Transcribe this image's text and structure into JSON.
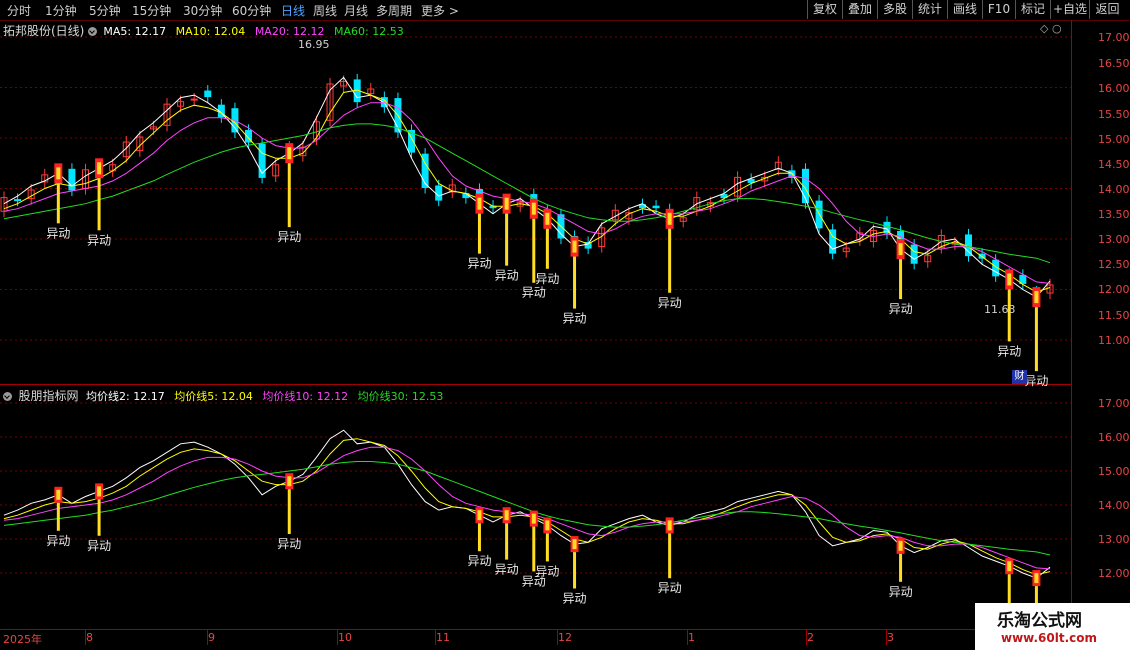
{
  "toolbar": {
    "periods": [
      "分时",
      "1分钟",
      "5分钟",
      "15分钟",
      "30分钟",
      "60分钟",
      "日线",
      "周线",
      "月线",
      "多周期",
      "更多 >"
    ],
    "active_period": "日线",
    "buttons": [
      "复权",
      "叠加",
      "多股",
      "统计",
      "画线",
      "F10",
      "标记",
      "+自选",
      "返回"
    ]
  },
  "main_panel": {
    "title": "拓邦股份(日线)",
    "ma_labels": [
      {
        "text": "MA5: 12.17",
        "color": "#ffffff"
      },
      {
        "text": "MA10: 12.04",
        "color": "#ffff00"
      },
      {
        "text": "MA20: 12.12",
        "color": "#ff44ff"
      },
      {
        "text": "MA60: 12.53",
        "color": "#22dd22"
      }
    ],
    "high_label": "16.95",
    "low_label": "11.63",
    "y_ticks": [
      "17.00",
      "16.50",
      "16.00",
      "15.50",
      "15.00",
      "14.50",
      "14.00",
      "13.50",
      "13.00",
      "12.50",
      "12.00",
      "11.50",
      "11.00"
    ],
    "cai_badge": "财"
  },
  "sub_panel": {
    "title": "股朋指标网",
    "labels": [
      {
        "text": "均价线2: 12.17",
        "color": "#ffffff"
      },
      {
        "text": "均价线5: 12.04",
        "color": "#ffff00"
      },
      {
        "text": "均价线10: 12.12",
        "color": "#ff44ff"
      },
      {
        "text": "均价线30: 12.53",
        "color": "#22dd22"
      }
    ],
    "y_ticks": [
      "17.00",
      "16.00",
      "15.00",
      "14.00",
      "13.00",
      "12.00"
    ]
  },
  "x_axis": [
    "2025年",
    "8",
    "9",
    "10",
    "11",
    "12",
    "1",
    "2",
    "3"
  ],
  "signal_label": "异动",
  "watermark": {
    "line1": "乐淘公式网",
    "line2": "www.60lt.com"
  },
  "colors": {
    "up": "#ff3b3b",
    "down": "#00e5ff",
    "ma5": "#ffffff",
    "ma10": "#ffff00",
    "ma20": "#ff44ff",
    "ma60": "#22dd22",
    "signal": "#ffdd22",
    "grid": "#7a0000"
  },
  "chart_data": {
    "type": "line",
    "title": "拓邦股份(日线)",
    "ylim": [
      10.7,
      17.3
    ],
    "x_ticks": [
      "2025年",
      "8",
      "9",
      "10",
      "11",
      "12",
      "1",
      "2",
      "3"
    ],
    "series": [
      {
        "name": "MA5",
        "values": [
          13.7,
          13.85,
          14.05,
          14.15,
          14.3,
          14.05,
          14.25,
          14.4,
          14.55,
          14.8,
          15.1,
          15.3,
          15.55,
          15.8,
          15.85,
          15.7,
          15.5,
          15.2,
          14.8,
          14.3,
          14.55,
          14.7,
          14.9,
          15.4,
          15.95,
          16.2,
          15.8,
          15.85,
          15.7,
          15.2,
          14.6,
          14.1,
          13.85,
          13.95,
          13.9,
          13.7,
          13.5,
          13.7,
          13.8,
          13.6,
          13.4,
          13.1,
          12.85,
          12.9,
          13.3,
          13.45,
          13.6,
          13.7,
          13.5,
          13.4,
          13.5,
          13.7,
          13.8,
          13.9,
          14.1,
          14.2,
          14.3,
          14.4,
          14.3,
          13.8,
          13.1,
          12.8,
          12.9,
          13.0,
          13.25,
          13.2,
          12.8,
          12.6,
          12.75,
          12.95,
          13.0,
          12.75,
          12.5,
          12.35,
          12.2,
          12.0,
          11.85,
          12.17
        ]
      },
      {
        "name": "MA10",
        "values": [
          13.6,
          13.7,
          13.85,
          14.0,
          14.1,
          14.05,
          14.1,
          14.2,
          14.35,
          14.55,
          14.85,
          15.1,
          15.35,
          15.55,
          15.65,
          15.6,
          15.5,
          15.3,
          15.0,
          14.7,
          14.6,
          14.6,
          14.7,
          15.0,
          15.5,
          15.9,
          15.95,
          15.85,
          15.75,
          15.45,
          15.0,
          14.5,
          14.1,
          13.95,
          13.9,
          13.8,
          13.65,
          13.65,
          13.7,
          13.65,
          13.5,
          13.25,
          13.0,
          12.9,
          13.05,
          13.3,
          13.5,
          13.6,
          13.55,
          13.45,
          13.45,
          13.55,
          13.65,
          13.8,
          13.95,
          14.1,
          14.2,
          14.3,
          14.3,
          14.0,
          13.5,
          13.05,
          12.9,
          12.95,
          13.1,
          13.15,
          13.0,
          12.75,
          12.7,
          12.85,
          12.95,
          12.85,
          12.65,
          12.45,
          12.3,
          12.1,
          11.95,
          12.04
        ]
      },
      {
        "name": "MA20",
        "values": [
          13.55,
          13.6,
          13.7,
          13.8,
          13.9,
          13.95,
          14.0,
          14.05,
          14.15,
          14.3,
          14.5,
          14.7,
          14.95,
          15.15,
          15.3,
          15.4,
          15.4,
          15.35,
          15.2,
          15.0,
          14.85,
          14.8,
          14.8,
          14.95,
          15.2,
          15.45,
          15.6,
          15.7,
          15.7,
          15.6,
          15.35,
          15.0,
          14.6,
          14.25,
          14.05,
          13.95,
          13.85,
          13.8,
          13.75,
          13.7,
          13.6,
          13.45,
          13.3,
          13.15,
          13.1,
          13.2,
          13.35,
          13.45,
          13.5,
          13.5,
          13.5,
          13.55,
          13.6,
          13.7,
          13.8,
          13.95,
          14.05,
          14.15,
          14.25,
          14.2,
          14.0,
          13.7,
          13.35,
          13.1,
          13.05,
          13.1,
          13.05,
          12.9,
          12.8,
          12.8,
          12.85,
          12.85,
          12.75,
          12.6,
          12.45,
          12.3,
          12.15,
          12.12
        ]
      },
      {
        "name": "MA60",
        "values": [
          13.4,
          13.45,
          13.5,
          13.55,
          13.6,
          13.65,
          13.7,
          13.78,
          13.85,
          13.95,
          14.05,
          14.15,
          14.28,
          14.4,
          14.52,
          14.62,
          14.72,
          14.8,
          14.86,
          14.9,
          14.95,
          15.0,
          15.05,
          15.12,
          15.2,
          15.25,
          15.28,
          15.28,
          15.25,
          15.2,
          15.1,
          15.0,
          14.85,
          14.7,
          14.55,
          14.4,
          14.25,
          14.1,
          13.95,
          13.8,
          13.68,
          13.58,
          13.5,
          13.42,
          13.38,
          13.35,
          13.35,
          13.38,
          13.42,
          13.48,
          13.55,
          13.62,
          13.7,
          13.76,
          13.8,
          13.8,
          13.78,
          13.74,
          13.7,
          13.65,
          13.6,
          13.52,
          13.45,
          13.38,
          13.32,
          13.25,
          13.18,
          13.1,
          13.02,
          12.95,
          12.9,
          12.85,
          12.8,
          12.75,
          12.7,
          12.66,
          12.62,
          12.53
        ]
      }
    ]
  }
}
